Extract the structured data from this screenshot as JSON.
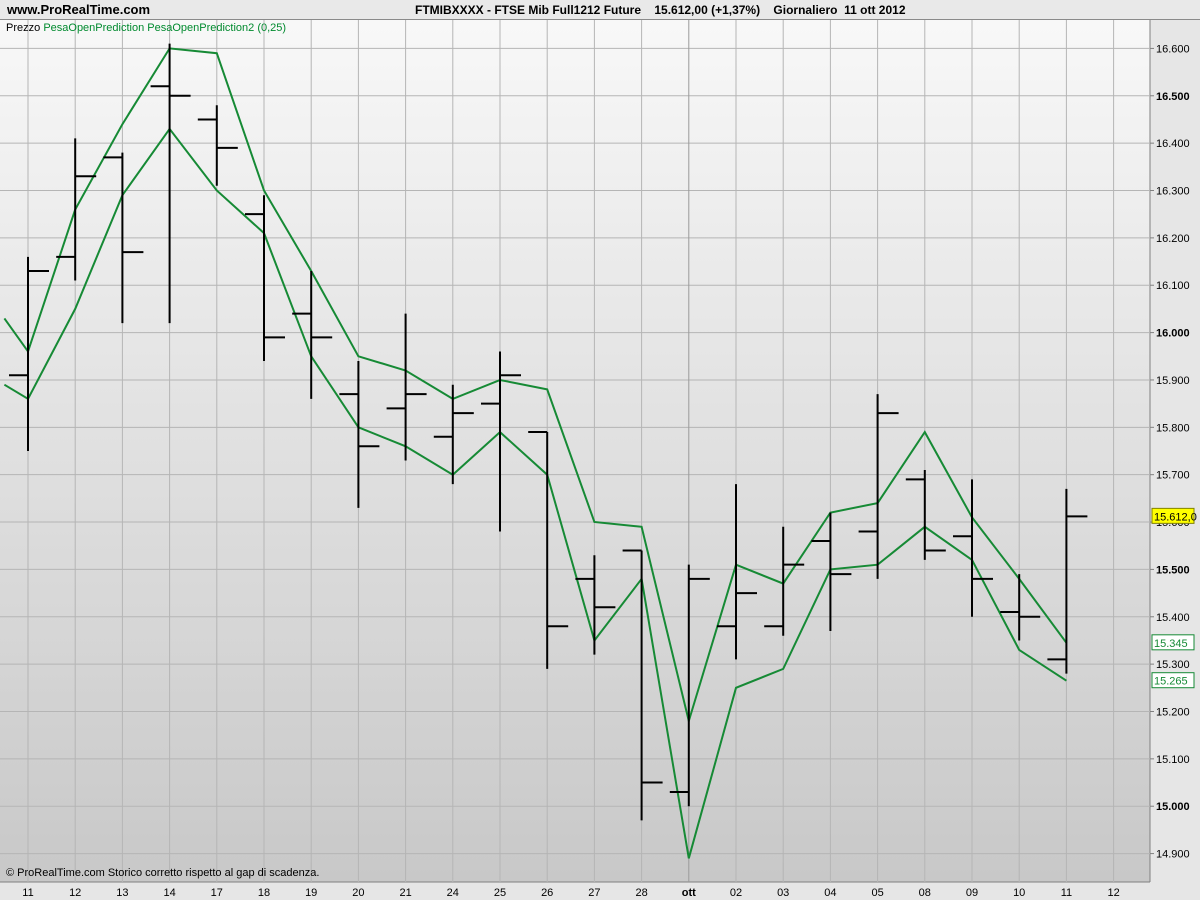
{
  "header": {
    "site": "www.ProRealTime.com",
    "title": "FTMIBXXXX - FTSE Mib Full1212 Future    15.612,00 (+1,37%)    Giornaliero  11 ott 2012"
  },
  "legend": {
    "price": "Prezzo",
    "indicators": "PesaOpenPrediction PesaOpenPrediction2 (0,25)"
  },
  "footer": {
    "copyright": "© ProRealTime.com  Storico corretto rispetto al gap di scadenza."
  },
  "colors": {
    "background_top": "#f8f8f8",
    "background_bottom": "#c8c8c8",
    "grid": "#b5b5b5",
    "bars": "#000000",
    "indicator": "#168a35",
    "last_price_badge": "#ffff00"
  },
  "chart_data": {
    "type": "line",
    "x_ticks": [
      "11",
      "12",
      "13",
      "14",
      "17",
      "18",
      "19",
      "20",
      "21",
      "24",
      "25",
      "26",
      "27",
      "28",
      "ott",
      "02",
      "03",
      "04",
      "05",
      "08",
      "09",
      "10",
      "11",
      "12"
    ],
    "y_ticks": [
      "14.900",
      "15.000",
      "15.100",
      "15.200",
      "15.300",
      "15.400",
      "15.500",
      "15.600",
      "15.700",
      "15.800",
      "15.900",
      "16.000",
      "16.100",
      "16.200",
      "16.300",
      "16.400",
      "16.500",
      "16.600"
    ],
    "ylim": [
      14.84,
      16.66
    ],
    "bar_type": "ohlc",
    "ohlc": [
      {
        "x": 0,
        "open": 15.91,
        "high": 16.16,
        "low": 15.75,
        "close": 16.13
      },
      {
        "x": 1,
        "open": 16.16,
        "high": 16.41,
        "low": 16.11,
        "close": 16.33
      },
      {
        "x": 2,
        "open": 16.37,
        "high": 16.38,
        "low": 16.02,
        "close": 16.17
      },
      {
        "x": 3,
        "open": 16.52,
        "high": 16.61,
        "low": 16.02,
        "close": 16.5
      },
      {
        "x": 4,
        "open": 16.45,
        "high": 16.48,
        "low": 16.31,
        "close": 16.39
      },
      {
        "x": 5,
        "open": 16.25,
        "high": 16.29,
        "low": 15.94,
        "close": 15.99
      },
      {
        "x": 6,
        "open": 16.04,
        "high": 16.13,
        "low": 15.86,
        "close": 15.99
      },
      {
        "x": 7,
        "open": 15.87,
        "high": 15.94,
        "low": 15.63,
        "close": 15.76
      },
      {
        "x": 8,
        "open": 15.84,
        "high": 16.04,
        "low": 15.73,
        "close": 15.87
      },
      {
        "x": 9,
        "open": 15.78,
        "high": 15.89,
        "low": 15.68,
        "close": 15.83
      },
      {
        "x": 10,
        "open": 15.85,
        "high": 15.96,
        "low": 15.58,
        "close": 15.91
      },
      {
        "x": 11,
        "open": 15.79,
        "high": 15.79,
        "low": 15.29,
        "close": 15.38
      },
      {
        "x": 12,
        "open": 15.48,
        "high": 15.53,
        "low": 15.32,
        "close": 15.42
      },
      {
        "x": 13,
        "open": 15.54,
        "high": 15.54,
        "low": 14.97,
        "close": 15.05
      },
      {
        "x": 14,
        "open": 15.03,
        "high": 15.51,
        "low": 15.0,
        "close": 15.48
      },
      {
        "x": 15,
        "open": 15.38,
        "high": 15.68,
        "low": 15.31,
        "close": 15.45
      },
      {
        "x": 16,
        "open": 15.38,
        "high": 15.59,
        "low": 15.36,
        "close": 15.51
      },
      {
        "x": 17,
        "open": 15.56,
        "high": 15.62,
        "low": 15.37,
        "close": 15.49
      },
      {
        "x": 18,
        "open": 15.58,
        "high": 15.87,
        "low": 15.48,
        "close": 15.83
      },
      {
        "x": 19,
        "open": 15.69,
        "high": 15.71,
        "low": 15.52,
        "close": 15.54
      },
      {
        "x": 20,
        "open": 15.57,
        "high": 15.69,
        "low": 15.4,
        "close": 15.48
      },
      {
        "x": 21,
        "open": 15.41,
        "high": 15.49,
        "low": 15.35,
        "close": 15.4
      },
      {
        "x": 22,
        "open": 15.31,
        "high": 15.67,
        "low": 15.28,
        "close": 15.612
      }
    ],
    "series": [
      {
        "name": "PesaOpenPrediction",
        "x": [
          -0.5,
          0,
          1,
          2,
          3,
          4,
          5,
          6,
          7,
          8,
          9,
          10,
          11,
          12,
          13,
          14,
          15,
          16,
          17,
          18,
          19,
          20,
          21,
          22
        ],
        "values": [
          16.03,
          15.96,
          16.26,
          16.44,
          16.6,
          16.59,
          16.3,
          16.13,
          15.95,
          15.92,
          15.86,
          15.9,
          15.88,
          15.6,
          15.59,
          15.18,
          15.51,
          15.47,
          15.62,
          15.64,
          15.79,
          15.61,
          15.48,
          15.345
        ]
      },
      {
        "name": "PesaOpenPrediction2",
        "x": [
          -0.5,
          0,
          1,
          2,
          3,
          4,
          5,
          6,
          7,
          8,
          9,
          10,
          11,
          12,
          13,
          14,
          15,
          16,
          17,
          18,
          19,
          20,
          21,
          22
        ],
        "values": [
          15.89,
          15.86,
          16.05,
          16.29,
          16.43,
          16.3,
          16.21,
          15.95,
          15.8,
          15.76,
          15.7,
          15.79,
          15.7,
          15.35,
          15.48,
          14.89,
          15.25,
          15.29,
          15.5,
          15.51,
          15.59,
          15.52,
          15.33,
          15.265
        ]
      }
    ],
    "value_labels": [
      {
        "text": "15.612,0",
        "value": 15.612,
        "style": "highlight"
      },
      {
        "text": "15.345",
        "value": 15.345,
        "style": "green"
      },
      {
        "text": "15.265",
        "value": 15.265,
        "style": "green"
      }
    ],
    "grid": true
  }
}
